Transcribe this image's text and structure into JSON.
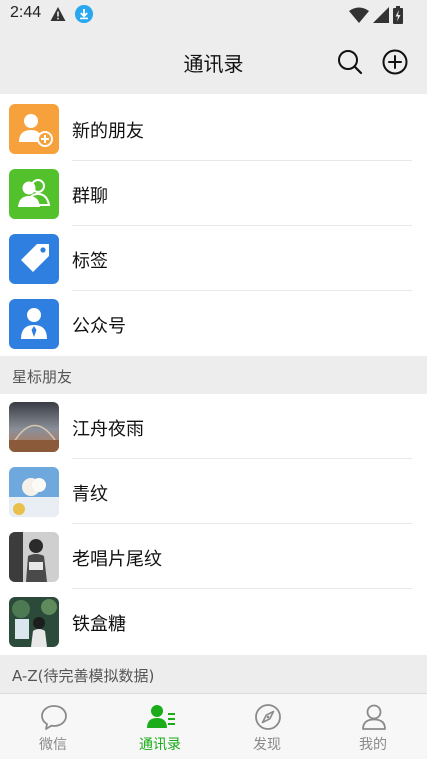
{
  "status_bar": {
    "time": "2:44"
  },
  "header": {
    "title": "通讯录"
  },
  "functions": [
    {
      "label": "新的朋友",
      "icon": "add-friend-icon",
      "color": "#f7a13c"
    },
    {
      "label": "群聊",
      "icon": "group-chat-icon",
      "color": "#53c12b"
    },
    {
      "label": "标签",
      "icon": "tag-icon",
      "color": "#2f7fe0"
    },
    {
      "label": "公众号",
      "icon": "official-account-icon",
      "color": "#2f7fe0"
    }
  ],
  "starred_section": {
    "title": "星标朋友"
  },
  "starred": [
    {
      "name": "江舟夜雨"
    },
    {
      "name": "青纹"
    },
    {
      "name": "老唱片尾纹"
    },
    {
      "name": "铁盒糖"
    }
  ],
  "az_section": {
    "title": "A-Z(待完善模拟数据)"
  },
  "bottom_nav": [
    {
      "label": "微信",
      "icon": "chat-bubble-icon",
      "active": false
    },
    {
      "label": "通讯录",
      "icon": "contacts-icon",
      "active": true
    },
    {
      "label": "发现",
      "icon": "compass-icon",
      "active": false
    },
    {
      "label": "我的",
      "icon": "person-icon",
      "active": false
    }
  ],
  "colors": {
    "accent": "#1aad19",
    "background": "#ededed"
  }
}
